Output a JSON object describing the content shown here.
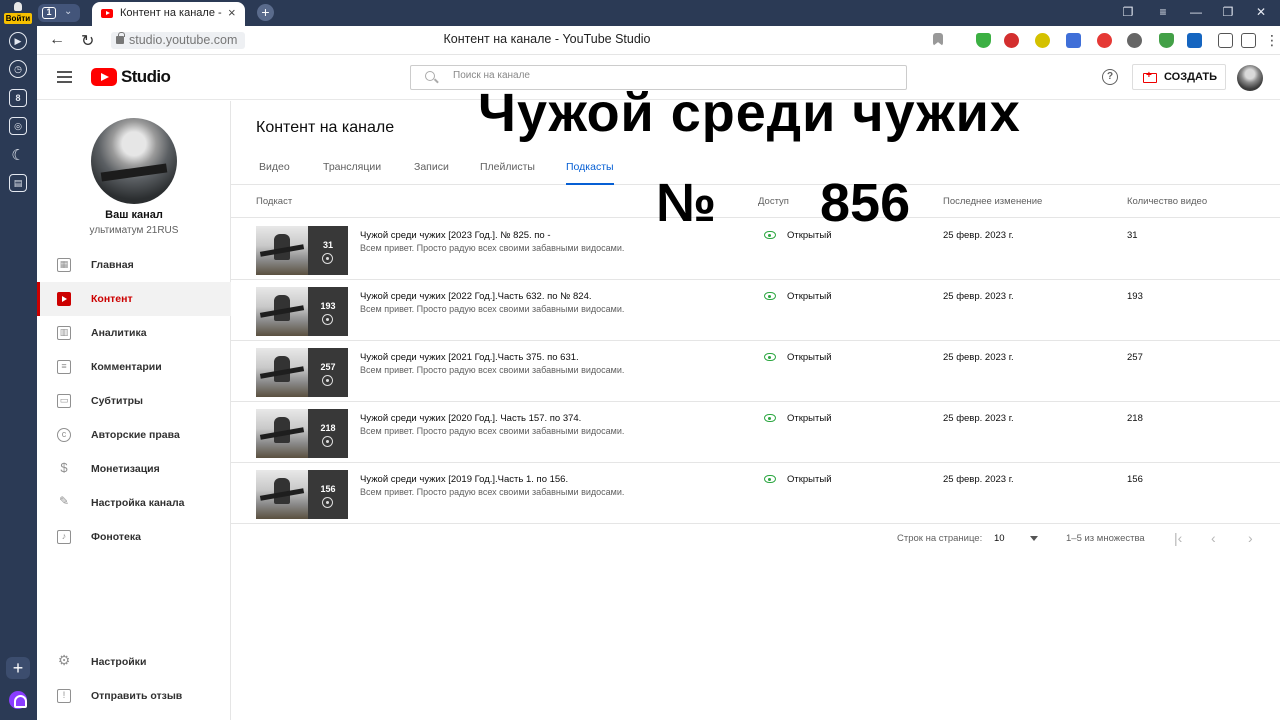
{
  "browser": {
    "login_label": "Войти",
    "tab_count": "1",
    "tab_title": "Контент на канале - YouTube Studio",
    "url": "studio.youtube.com",
    "page_title": "Контент на канале - YouTube Studio"
  },
  "header": {
    "logo_text": "Studio",
    "search_placeholder": "Поиск на канале",
    "create_label": "СОЗДАТЬ",
    "help_glyph": "?"
  },
  "channel": {
    "name": "Ваш канал",
    "handle": "ультиматум 21RUS"
  },
  "nav": {
    "items": [
      {
        "label": "Главная",
        "icon": "dashboard-icon"
      },
      {
        "label": "Контент",
        "icon": "content-play-icon"
      },
      {
        "label": "Аналитика",
        "icon": "analytics-icon"
      },
      {
        "label": "Комментарии",
        "icon": "comments-icon"
      },
      {
        "label": "Субтитры",
        "icon": "subtitles-icon"
      },
      {
        "label": "Авторские права",
        "icon": "copyright-icon"
      },
      {
        "label": "Монетизация",
        "icon": "dollar-icon"
      },
      {
        "label": "Настройка канала",
        "icon": "magic-wand-icon"
      },
      {
        "label": "Фонотека",
        "icon": "audio-library-icon"
      }
    ],
    "bottom": [
      {
        "label": "Настройки",
        "icon": "gear-icon"
      },
      {
        "label": "Отправить отзыв",
        "icon": "feedback-icon"
      }
    ]
  },
  "main": {
    "heading": "Контент на канале",
    "tabs": [
      "Видео",
      "Трансляции",
      "Записи",
      "Плейлисты",
      "Подкасты"
    ],
    "active_tab": "Подкасты",
    "columns": {
      "podcast": "Подкаст",
      "access": "Доступ",
      "modified": "Последнее изменение",
      "video_count": "Количество видео"
    },
    "rows": [
      {
        "count": "31",
        "title": "Чужой среди чужих [2023 Год.]. № 825. по -",
        "desc": "Всем привет. Просто радую всех своими забавными видосами.",
        "access": "Открытый",
        "date": "25 февр. 2023 г.",
        "videos": "31"
      },
      {
        "count": "193",
        "title": "Чужой среди чужих [2022 Год.].Часть 632. по № 824.",
        "desc": "Всем привет. Просто радую всех своими забавными видосами.",
        "access": "Открытый",
        "date": "25 февр. 2023 г.",
        "videos": "193"
      },
      {
        "count": "257",
        "title": "Чужой среди чужих [2021 Год.].Часть 375. по 631.",
        "desc": "Всем привет. Просто радую всех своими забавными видосами.",
        "access": "Открытый",
        "date": "25 февр. 2023 г.",
        "videos": "257"
      },
      {
        "count": "218",
        "title": "Чужой среди чужих [2020 Год.]. Часть 157. по 374.",
        "desc": "Всем привет. Просто радую всех своими забавными видосами.",
        "access": "Открытый",
        "date": "25 февр. 2023 г.",
        "videos": "218"
      },
      {
        "count": "156",
        "title": "Чужой среди чужих [2019 Год.].Часть 1. по 156.",
        "desc": "Всем привет. Просто радую всех своими забавными видосами.",
        "access": "Открытый",
        "date": "25 февр. 2023 г.",
        "videos": "156"
      }
    ],
    "pagination": {
      "rows_per_page_label": "Строк на странице:",
      "rows_per_page": "10",
      "range": "1–5 из множества"
    }
  },
  "overlay": {
    "title": "Чужой среди чужих",
    "number_sign": "№",
    "number": "856"
  },
  "colors": {
    "accent_red": "#cc0000",
    "tab_blue": "#065fd4",
    "public_green": "#2ba640",
    "browser_chrome": "#2b3a55"
  }
}
